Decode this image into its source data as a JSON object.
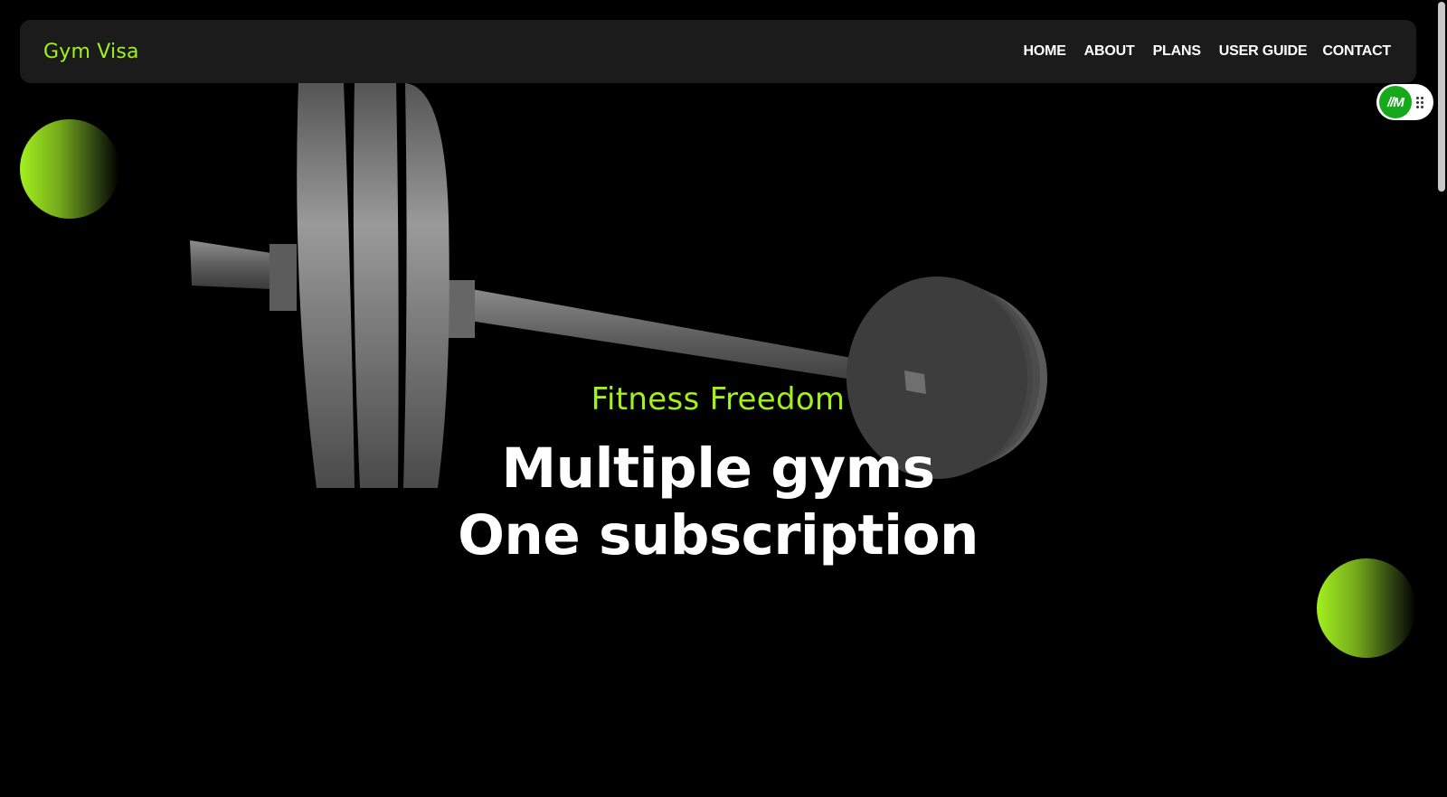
{
  "navbar": {
    "brand": "Gym Visa",
    "links": [
      {
        "label": "HOME"
      },
      {
        "label": "ABOUT"
      },
      {
        "label": "PLANS"
      },
      {
        "label": "USER GUIDE"
      },
      {
        "label": "CONTACT"
      }
    ]
  },
  "widget": {
    "logo_text": "//M",
    "icon": "drag-handle-icon"
  },
  "hero": {
    "eyebrow": "Fitness Freedom",
    "headline_line1": "Multiple gyms",
    "headline_line2": "One subscription",
    "graphic": "barbell-3d"
  },
  "colors": {
    "accent": "#a3f01f",
    "background": "#000000",
    "navbar_bg": "#1b1b1b",
    "widget_green": "#17a91c"
  }
}
